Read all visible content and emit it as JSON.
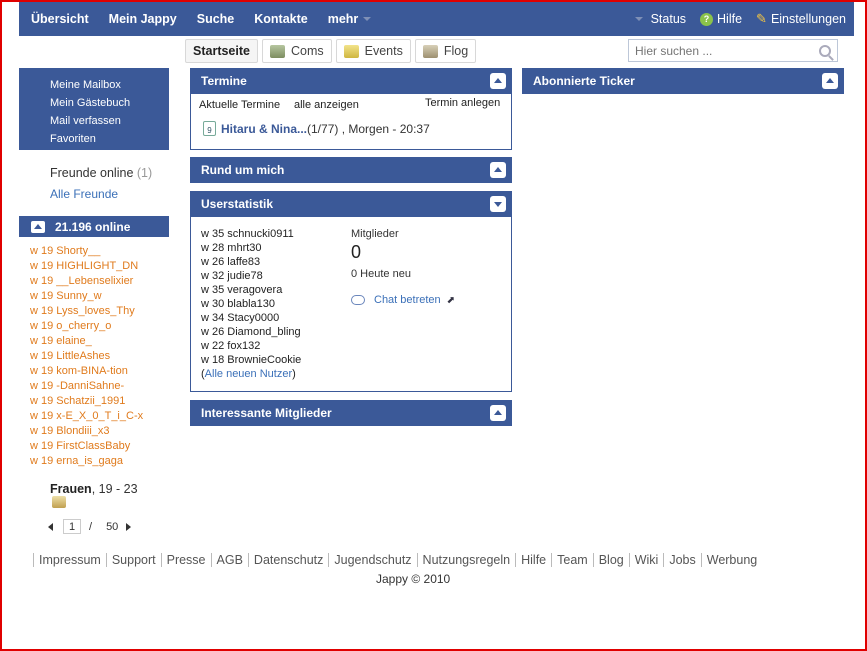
{
  "topnav": {
    "items": [
      "Übersicht",
      "Mein Jappy",
      "Suche",
      "Kontakte",
      "mehr"
    ],
    "status": "Status",
    "help": "Hilfe",
    "settings": "Einstellungen"
  },
  "subnav": {
    "tabs": [
      "Startseite",
      "Coms",
      "Events",
      "Flog"
    ]
  },
  "search": {
    "placeholder": "Hier suchen ..."
  },
  "sidebar": {
    "links": [
      "Meine Mailbox",
      "Mein Gästebuch",
      "Mail verfassen",
      "Favoriten"
    ],
    "friends_online_label": "Freunde online",
    "friends_online_count": "(1)",
    "all_friends": "Alle Freunde",
    "online_count_label": "21.196 online",
    "online_users": [
      "w 19 Shorty__",
      "w 19 HIGHLIGHT_DN",
      "w 19 __Lebenselixier",
      "w 19 Sunny_w",
      "w 19 Lyss_loves_Thy",
      "w 19 o_cherry_o",
      "w 19 elaine_",
      "w 19 LittleAshes",
      "w 19 kom-BINA-tion",
      "w 19 -DanniSahne-",
      "w 19 Schatzii_1991",
      "w 19 x-E_X_0_T_i_C-x",
      "w 19 Blondiii_x3",
      "w 19 FirstClassBaby",
      "w 19 erna_is_gaga"
    ],
    "filter_gender": "Frauen",
    "filter_age": ", 19 - 23",
    "pager": {
      "current": "1",
      "separator": "/",
      "total": "50"
    }
  },
  "termine": {
    "title": "Termine",
    "current_label": "Aktuelle Termine",
    "show_all": "alle anzeigen",
    "create": "Termin anlegen",
    "event_name": "Hitaru & Nina...",
    "event_rest": " (1/77) , Morgen - 20:37",
    "calendar_day": "9"
  },
  "rund_um_mich": {
    "title": "Rund um mich"
  },
  "userstatistik": {
    "title": "Userstatistik",
    "users": [
      "w 35 schnucki0911",
      "w 28 mhrt30",
      "w 26 laffe83",
      "w 32 judie78",
      "w 35 veragovera",
      "w 30 blabla130",
      "w 34 Stacy0000",
      "w 26 Diamond_bling",
      "w 22 fox132",
      "w 18 BrownieCookie"
    ],
    "all_new_open": "(",
    "all_new_link": "Alle neuen Nutzer",
    "all_new_close": ")",
    "members_label": "Mitglieder",
    "members_count": "0",
    "new_today": "0 Heute neu",
    "chat_enter": "Chat betreten"
  },
  "interessante": {
    "title": "Interessante Mitglieder"
  },
  "ticker": {
    "title": "Abonnierte Ticker"
  },
  "footer": {
    "links": [
      "Impressum",
      "Support",
      "Presse",
      "AGB",
      "Datenschutz",
      "Jugendschutz",
      "Nutzungsregeln",
      "Hilfe",
      "Team",
      "Blog",
      "Wiki",
      "Jobs",
      "Werbung"
    ],
    "copyright": "Jappy © 2010"
  },
  "colors": {
    "brand": "#3b5998",
    "accent_orange": "#e07b1d",
    "link": "#3b70b8",
    "window_border": "#e00000"
  }
}
